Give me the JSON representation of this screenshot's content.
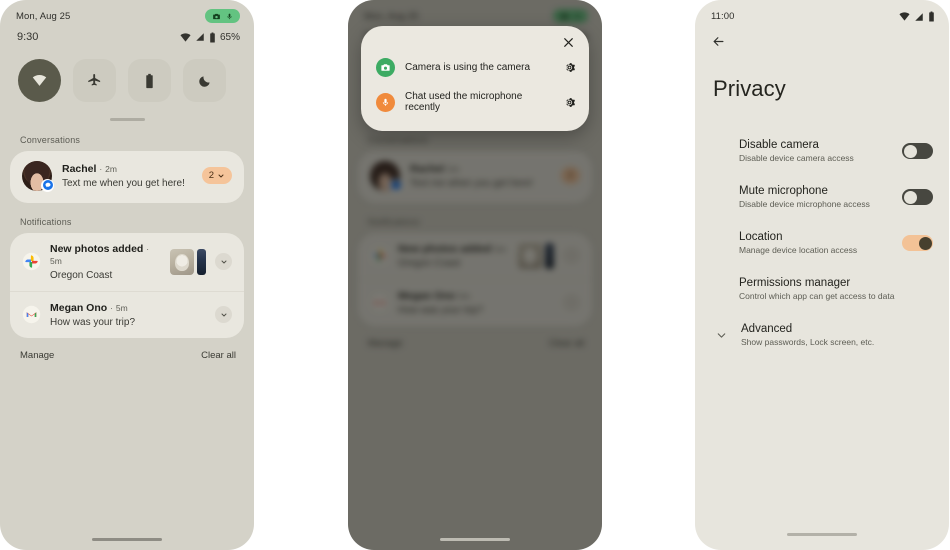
{
  "panels": {
    "notification_shade": {
      "name": "notification-shade",
      "status": {
        "date": "Mon, Aug 25",
        "privacy_chip": {
          "camera_icon": "camera-icon",
          "mic_icon": "microphone-icon",
          "color": "#63c381"
        }
      },
      "quick_settings": {
        "time": "9:30",
        "battery_percent": "65%",
        "signal_icons": [
          "wifi-icon",
          "cell-signal-icon",
          "battery-icon"
        ],
        "tiles": [
          {
            "label": "Internet",
            "icon": "wifi-icon",
            "state": "on"
          },
          {
            "label": "Airplane mode",
            "icon": "airplane-icon",
            "state": "off"
          },
          {
            "label": "Battery saver",
            "icon": "battery-icon",
            "state": "off"
          },
          {
            "label": "Dark theme",
            "icon": "moon-icon",
            "state": "off"
          }
        ]
      },
      "conversations": {
        "header": "Conversations",
        "items": [
          {
            "sender": "Rachel",
            "separator": "·",
            "time": "2m",
            "message": "Text me when you get here!",
            "count": "2",
            "badge_app": "messages-icon"
          }
        ]
      },
      "notifications": {
        "header": "Notifications",
        "items": [
          {
            "app_icon": "google-photos-icon",
            "title": "New photos added",
            "separator": "·",
            "time": "5m",
            "subtitle": "Oregon Coast",
            "has_thumbnails": true
          },
          {
            "app_icon": "gmail-icon",
            "title": "Megan Ono",
            "separator": "·",
            "time": "5m",
            "subtitle": "How was your trip?",
            "has_thumbnails": false
          }
        ]
      },
      "footer": {
        "manage": "Manage",
        "clear_all": "Clear all"
      }
    },
    "privacy_dialog": {
      "name": "privacy-indicator-dialog",
      "close_icon": "close-icon",
      "items": [
        {
          "icon": "camera-icon",
          "icon_color": "#3dab63",
          "label": "Camera is using the camera",
          "settings_icon": "gear-icon"
        },
        {
          "icon": "microphone-icon",
          "icon_color": "#f08a3c",
          "label": "Chat used the microphone recently",
          "settings_icon": "gear-icon"
        }
      ]
    },
    "privacy_settings": {
      "name": "privacy-settings-screen",
      "status": {
        "time": "11:00",
        "icons": [
          "wifi-icon",
          "cell-signal-icon",
          "battery-icon"
        ]
      },
      "back_icon": "back-arrow-icon",
      "title": "Privacy",
      "items": [
        {
          "name": "Disable camera",
          "desc": "Disable device camera access",
          "control": "switch",
          "state": "off"
        },
        {
          "name": "Mute microphone",
          "desc": "Disable device microphone access",
          "control": "switch",
          "state": "off"
        },
        {
          "name": "Location",
          "desc": "Manage device location access",
          "control": "switch",
          "state": "on"
        },
        {
          "name": "Permissions manager",
          "desc": "Control which app can get access to data",
          "control": "none",
          "state": ""
        },
        {
          "name": "Advanced",
          "desc": "Show passwords, Lock screen, etc.",
          "control": "chevron",
          "state": "collapsed"
        }
      ]
    }
  },
  "colors": {
    "panel_bg": "#d4d2c8",
    "card_bg": "#e9e7df",
    "accent_orange": "#f3c296",
    "accent_green": "#63c381",
    "settings_bg": "#e7e5dd"
  }
}
